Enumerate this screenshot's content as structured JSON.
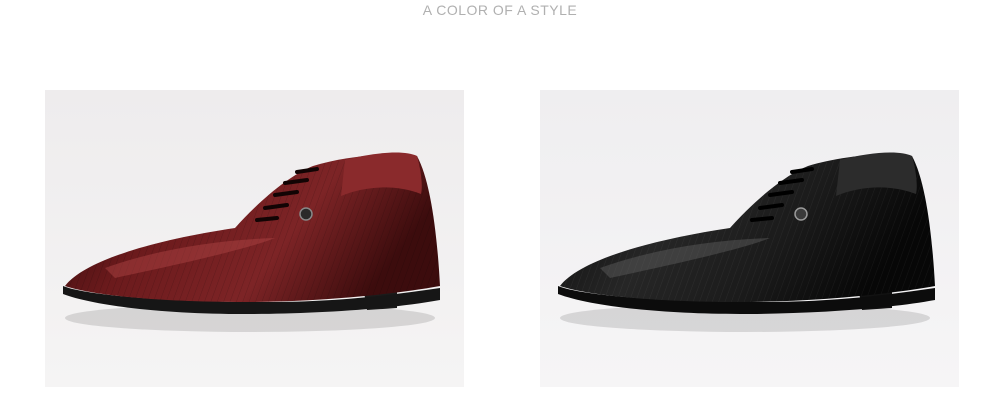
{
  "heading": "A COLOR OF A STYLE",
  "products": [
    {
      "color_name": "burgundy",
      "backdrop": "#f1eff0",
      "upper": "#5e1516",
      "upper_highlight": "#9a3a3c",
      "sole": "#1c1c1c"
    },
    {
      "color_name": "black",
      "backdrop": "#f2f1f3",
      "upper": "#141414",
      "upper_highlight": "#4a4a4a",
      "sole": "#0e0e0e"
    }
  ]
}
